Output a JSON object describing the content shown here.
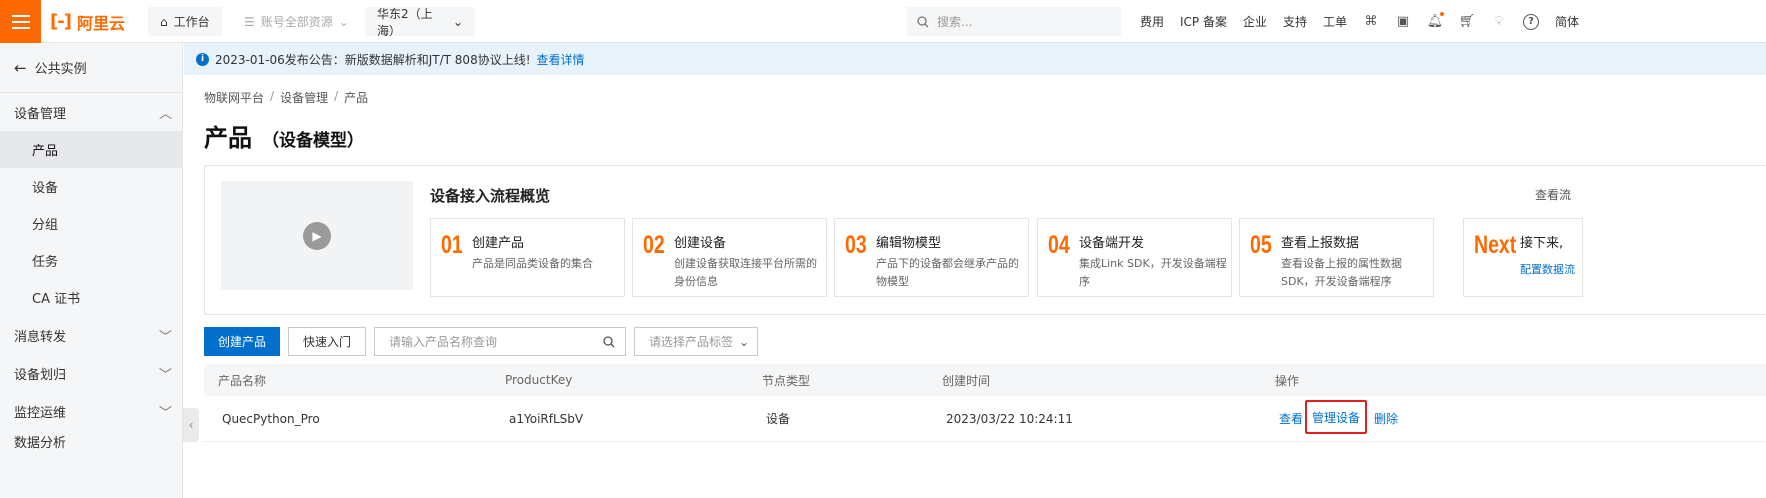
{
  "topbar": {
    "logo_text": "阿里云",
    "workbench_label": "工作台",
    "resource_label": "账号全部资源",
    "region_label": "华东2（上海）",
    "search_placeholder": "搜索...",
    "links": [
      "费用",
      "ICP 备案",
      "企业",
      "支持",
      "工单"
    ],
    "lang_label": "简体"
  },
  "sidebar": {
    "back_label": "公共实例",
    "groups": [
      {
        "label": "设备管理",
        "expanded": true,
        "items": [
          "产品",
          "设备",
          "分组",
          "任务",
          "CA 证书"
        ],
        "active": "产品"
      },
      {
        "label": "消息转发",
        "expanded": false
      },
      {
        "label": "设备划归",
        "expanded": false
      },
      {
        "label": "监控运维",
        "expanded": false
      },
      {
        "label": "数据分析",
        "expanded": false
      }
    ]
  },
  "notice": {
    "text": "2023-01-06发布公告：新版数据解析和JT/T 808协议上线!",
    "link": "查看详情"
  },
  "breadcrumb": [
    "物联网平台",
    "设备管理",
    "产品"
  ],
  "page": {
    "title": "产品",
    "subtitle": "（设备模型）"
  },
  "flow": {
    "title": "设备接入流程概览",
    "more_label": "查看流",
    "steps": [
      {
        "num": "01",
        "name": "创建产品",
        "desc": "产品是同品类设备的集合"
      },
      {
        "num": "02",
        "name": "创建设备",
        "desc": "创建设备获取连接平台所需的身份信息"
      },
      {
        "num": "03",
        "name": "编辑物模型",
        "desc": "产品下的设备都会继承产品的物模型"
      },
      {
        "num": "04",
        "name": "设备端开发",
        "desc": "集成Link SDK，开发设备端程序"
      },
      {
        "num": "05",
        "name": "查看上报数据",
        "desc": "查看设备上报的属性数据 SDK，开发设备端程序"
      },
      {
        "num": "Next",
        "name": "接下来,",
        "link": "配置数据流"
      }
    ]
  },
  "toolbar": {
    "create_label": "创建产品",
    "quick_label": "快速入门",
    "search_placeholder": "请输入产品名称查询",
    "tag_placeholder": "请选择产品标签"
  },
  "table": {
    "headers": [
      "产品名称",
      "ProductKey",
      "节点类型",
      "创建时间",
      "操作"
    ],
    "rows": [
      {
        "name": "QuecPython_Pro",
        "key": "a1YoiRfLSbV",
        "type": "设备",
        "created": "2023/03/22 10:24:11",
        "ops": [
          "查看",
          "管理设备",
          "删除"
        ]
      }
    ]
  },
  "colors": {
    "brand": "#ff6a00",
    "primary": "#0070cc",
    "highlight": "#e02020"
  }
}
